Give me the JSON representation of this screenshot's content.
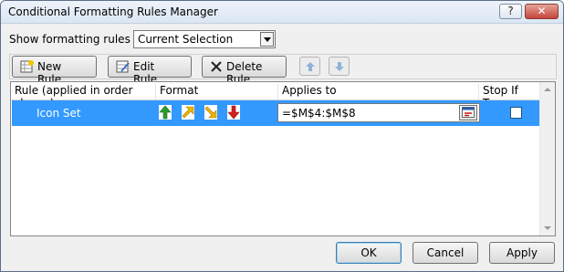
{
  "window": {
    "title": "Conditional Formatting Rules Manager",
    "help_glyph": "?",
    "close_glyph": "✕"
  },
  "filter": {
    "label": "Show formatting rules for:",
    "value": "Current Selection"
  },
  "toolbar": {
    "new_rule": "New Rule...",
    "edit_rule": "Edit Rule...",
    "delete_rule": "Delete Rule"
  },
  "grid": {
    "headers": {
      "rule": "Rule (applied in order shown)",
      "format": "Format",
      "applies_to": "Applies to",
      "stop_if_true": "Stop If True"
    },
    "rows": [
      {
        "rule": "Icon Set",
        "format_icons": [
          "green-up-arrow-icon",
          "yellow-up-right-arrow-icon",
          "yellow-down-right-arrow-icon",
          "red-down-arrow-icon"
        ],
        "applies_to": "=$M$4:$M$8",
        "stop_if_true": false,
        "selected": true
      }
    ]
  },
  "footer": {
    "ok": "OK",
    "cancel": "Cancel",
    "apply": "Apply"
  },
  "colors": {
    "selection": "#3399ff",
    "up_arrow": "#2e9a2e",
    "sideways_arrow": "#f0b400",
    "down_arrow": "#d42020"
  }
}
